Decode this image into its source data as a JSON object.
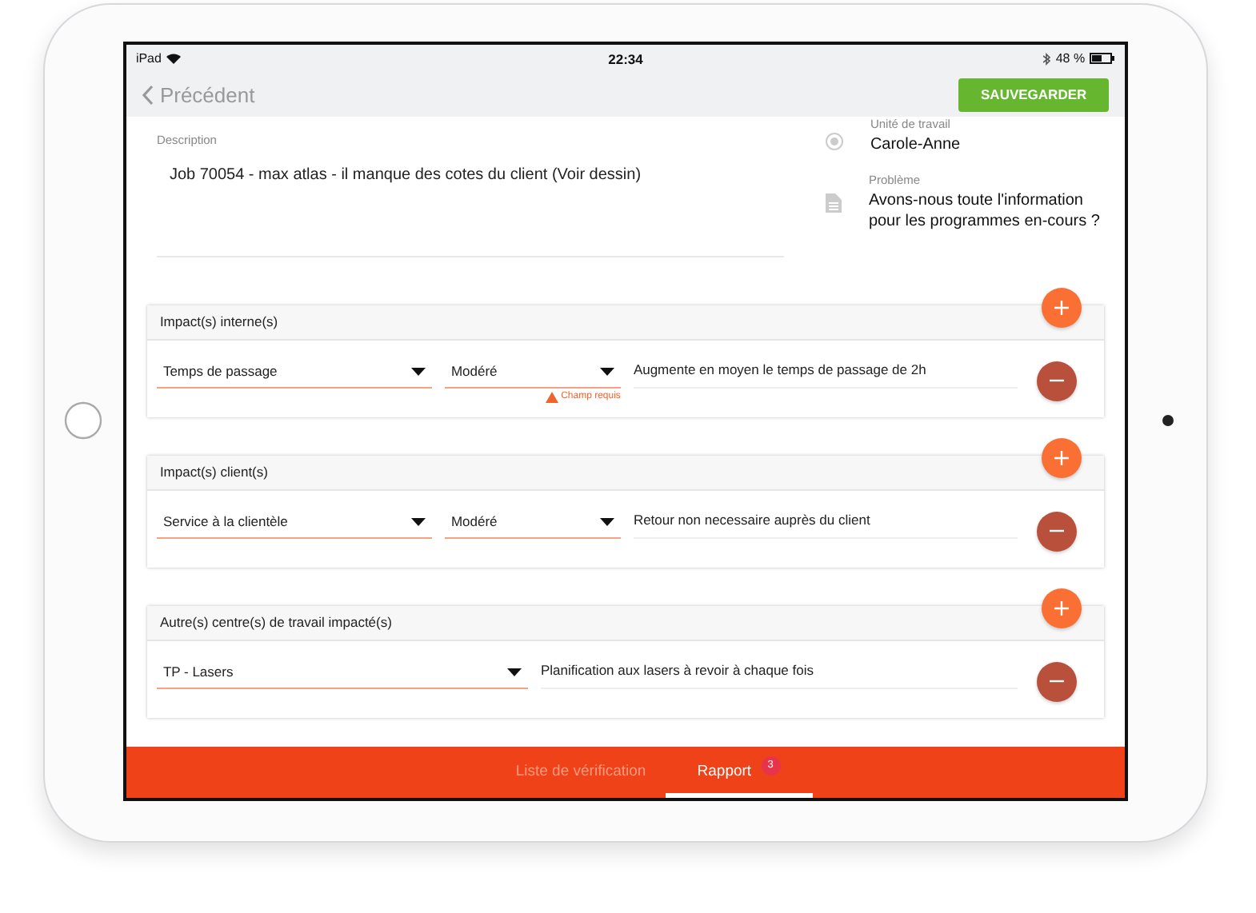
{
  "status_bar": {
    "device": "iPad",
    "time": "22:34",
    "battery": "48 %"
  },
  "nav": {
    "back": "Précédent",
    "save": "SAUVEGARDER"
  },
  "description": {
    "label": "Description",
    "value": "Job 70054 - max atlas - il manque des cotes du client (Voir dessin)"
  },
  "info": [
    {
      "kind": "person",
      "label": "Unité de travail",
      "value": "Carole-Anne"
    },
    {
      "kind": "document",
      "label": "Problème",
      "value": "Avons-nous toute l'information pour les programmes en-cours ?"
    }
  ],
  "sections": [
    {
      "title": "Impact(s) interne(s)",
      "rows": [
        {
          "dropdowns": [
            {
              "value": "Temps de passage"
            },
            {
              "value": "Modéré",
              "error": "Champ requis"
            }
          ],
          "text": "Augmente en moyen le temps de passage de 2h"
        }
      ]
    },
    {
      "title": "Impact(s) client(s)",
      "rows": [
        {
          "dropdowns": [
            {
              "value": "Service à la clientèle"
            },
            {
              "value": "Modéré"
            }
          ],
          "text": "Retour non necessaire auprès du client"
        }
      ]
    },
    {
      "title": "Autre(s) centre(s) de travail impacté(s)",
      "rows": [
        {
          "dropdowns": [
            {
              "value": "TP - Lasers"
            }
          ],
          "text": "Planification aux lasers à revoir à chaque fois"
        }
      ]
    }
  ],
  "tabs": [
    {
      "label": "Liste de vérification",
      "selected": false
    },
    {
      "label": "Rapport",
      "selected": true,
      "badge": "3"
    }
  ]
}
